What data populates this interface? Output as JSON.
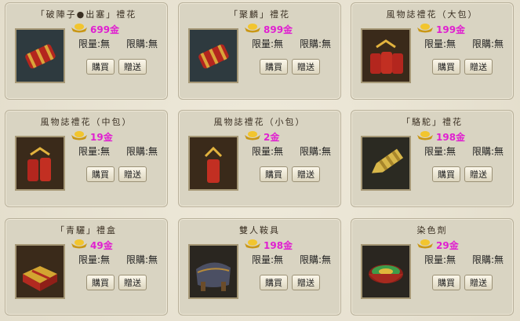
{
  "currency_unit": "金",
  "buy_label": "購買",
  "gift_label": "贈送",
  "limit_qty_label": "限量:無",
  "limit_buy_label": "限購:無",
  "items": [
    {
      "title": "「破陣子●出塞」禮花",
      "price": "699金",
      "icon": "firework-bundle-icon"
    },
    {
      "title": "「聚麟」禮花",
      "price": "899金",
      "icon": "firework-bundle-icon"
    },
    {
      "title": "風物誌禮花（大包）",
      "price": "199金",
      "icon": "firework-bundle-icon"
    },
    {
      "title": "風物誌禮花（中包）",
      "price": "19金",
      "icon": "firework-bundle-icon"
    },
    {
      "title": "風物誌禮花（小包）",
      "price": "2金",
      "icon": "firework-bundle-icon"
    },
    {
      "title": "「駱駝」禮花",
      "price": "198金",
      "icon": "firework-golden-icon"
    },
    {
      "title": "「青驪」禮盒",
      "price": "49金",
      "icon": "gift-box-icon"
    },
    {
      "title": "雙人鞍具",
      "price": "198金",
      "icon": "saddle-icon"
    },
    {
      "title": "染色劑",
      "price": "29金",
      "icon": "dye-bowl-icon"
    }
  ],
  "colors": {
    "price": "#e020d0",
    "card_bg": "#d9d4c2"
  }
}
